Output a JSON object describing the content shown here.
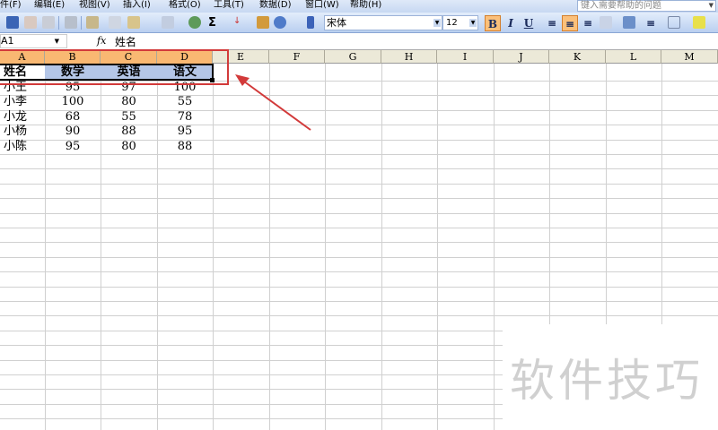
{
  "menu": [
    "件(F)",
    "编辑(E)",
    "视图(V)",
    "插入(I)",
    "格式(O)",
    "工具(T)",
    "数据(D)",
    "窗口(W)",
    "帮助(H)"
  ],
  "help_placeholder": "键入需要帮助的问题",
  "toolbar": {
    "font": "宋体",
    "size": "12",
    "bold": "B",
    "italic": "I",
    "underline": "U",
    "sum": "Σ"
  },
  "formula": {
    "name_box": "A1",
    "fx": "fx",
    "value": "姓名"
  },
  "columns": [
    "A",
    "B",
    "C",
    "D",
    "E",
    "F",
    "G",
    "H",
    "I",
    "J",
    "K",
    "L",
    "M"
  ],
  "headers": [
    "姓名",
    "数学",
    "英语",
    "语文"
  ],
  "rows": [
    [
      "小王",
      "95",
      "97",
      "100"
    ],
    [
      "小李",
      "100",
      "80",
      "55"
    ],
    [
      "小龙",
      "68",
      "55",
      "78"
    ],
    [
      "小杨",
      "90",
      "88",
      "95"
    ],
    [
      "小陈",
      "95",
      "80",
      "88"
    ]
  ],
  "watermark": "软件技巧",
  "colors": {
    "selected_header": "#f9b872",
    "annotation": "#d23a3a"
  }
}
